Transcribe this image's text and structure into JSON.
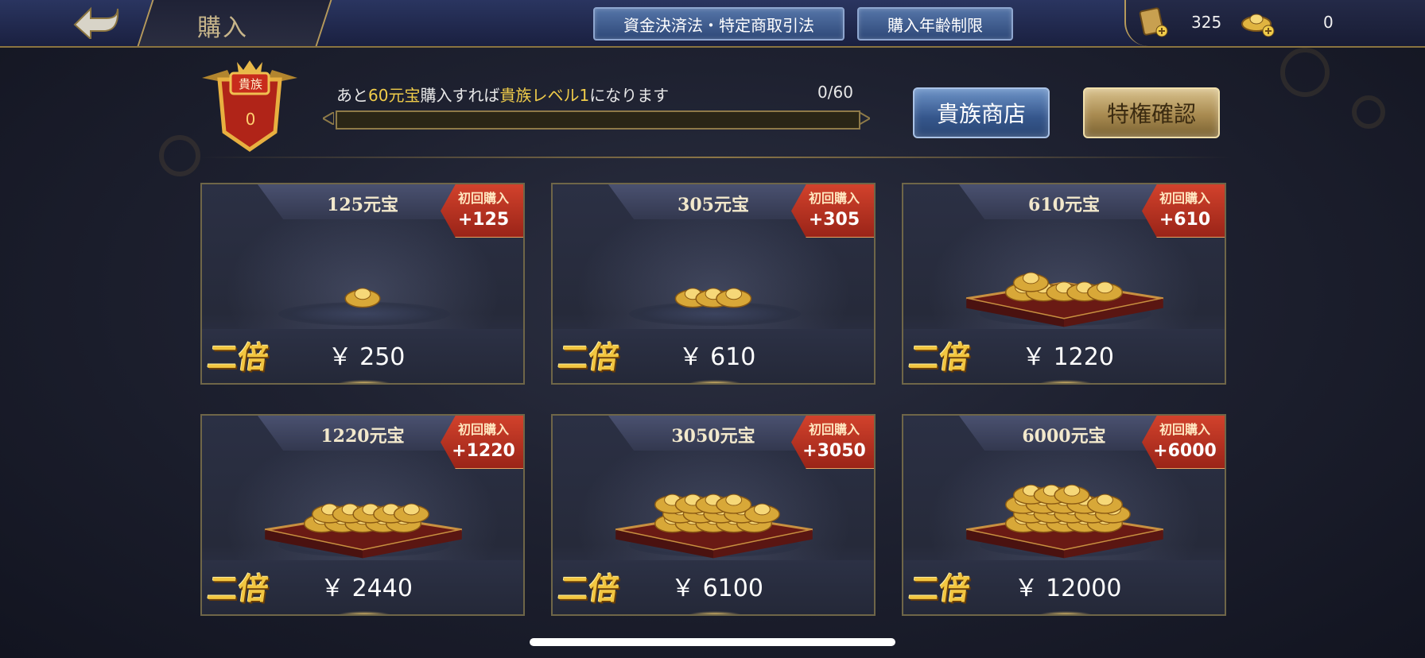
{
  "header": {
    "title": "購入",
    "links": [
      "資金決済法・特定商取引法",
      "購入年齢制限"
    ],
    "currencies": [
      {
        "icon": "ticket-icon",
        "value": "325"
      },
      {
        "icon": "gold-ingot-icon",
        "value": "0"
      }
    ]
  },
  "noble": {
    "badge_label": "貴族",
    "level": "0",
    "message_prefix": "あと",
    "message_amount": "60元宝",
    "message_mid": "購入すれば",
    "message_level": "貴族レベル1",
    "message_suffix": "になります",
    "progress_text": "0/60",
    "progress_fraction": 0,
    "shop_button": "貴族商店",
    "privilege_button": "特権確認"
  },
  "cards": [
    {
      "amount": "125元宝",
      "ribbon_label": "初回購入",
      "bonus": "+125",
      "badge": "二倍",
      "price": "￥ 250"
    },
    {
      "amount": "305元宝",
      "ribbon_label": "初回購入",
      "bonus": "+305",
      "badge": "二倍",
      "price": "￥ 610"
    },
    {
      "amount": "610元宝",
      "ribbon_label": "初回購入",
      "bonus": "+610",
      "badge": "二倍",
      "price": "￥ 1220"
    },
    {
      "amount": "1220元宝",
      "ribbon_label": "初回購入",
      "bonus": "+1220",
      "badge": "二倍",
      "price": "￥ 2440"
    },
    {
      "amount": "3050元宝",
      "ribbon_label": "初回購入",
      "bonus": "+3050",
      "badge": "二倍",
      "price": "￥ 6100"
    },
    {
      "amount": "6000元宝",
      "ribbon_label": "初回購入",
      "bonus": "+6000",
      "badge": "二倍",
      "price": "￥ 12000"
    }
  ],
  "colors": {
    "accent_gold": "#f0cc4a",
    "ribbon_red": "#c0392b",
    "button_blue": "#35568c"
  }
}
